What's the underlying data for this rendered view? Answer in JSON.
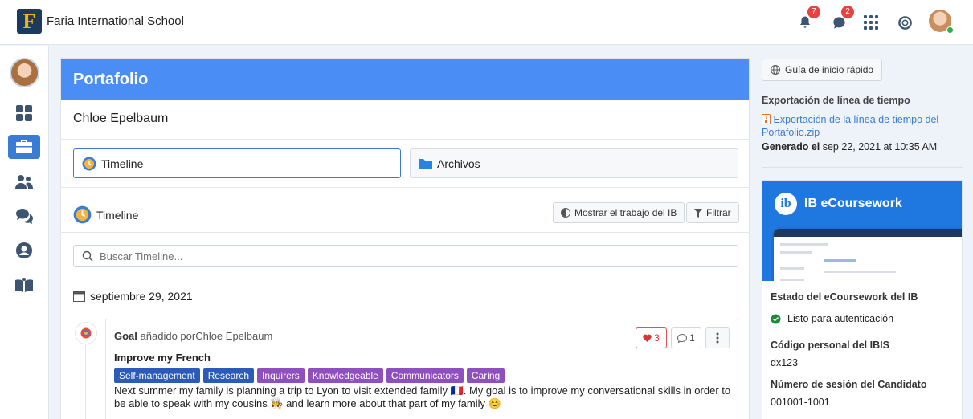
{
  "topbar": {
    "logo_letter": "F",
    "school_name": "Faria International School",
    "notifications_count": "7",
    "messages_count": "2"
  },
  "main": {
    "header_title": "Portafolio",
    "student_name": "Chloe Epelbaum",
    "tabs": [
      {
        "label": "Timeline"
      },
      {
        "label": "Archivos"
      }
    ],
    "timeline_title": "Timeline",
    "show_ib_button": "Mostrar el trabajo del IB",
    "filter_button": "Filtrar",
    "search_placeholder": "Buscar Timeline...",
    "date": "septiembre 29, 2021",
    "entry": {
      "type": "Goal",
      "added_by": "añadido porChloe Epelbaum",
      "title": "Improve my French",
      "tags": [
        {
          "label": "Self-management",
          "color": "#2c5ab8"
        },
        {
          "label": "Research",
          "color": "#2c5ab8"
        },
        {
          "label": "Inquirers",
          "color": "#8e4fbf"
        },
        {
          "label": "Knowledgeable",
          "color": "#8e4fbf"
        },
        {
          "label": "Communicators",
          "color": "#8e4fbf"
        },
        {
          "label": "Caring",
          "color": "#8e4fbf"
        }
      ],
      "text": "Next summer my family is planning a trip to Lyon to visit extended family 🇫🇷. My goal is to improve my conversational skills in order to be able to speak with my cousins 👩‍🍳 and learn more about that part of my family 😊",
      "likes": "3",
      "comments": "1"
    }
  },
  "right": {
    "guide_button": "Guía de inicio rápido",
    "export_label": "Exportación de línea de tiempo",
    "export_link": "Exportación de la línea de tiempo del Portafolio.zip",
    "generated_prefix": "Generado el",
    "generated_date": "sep 22, 2021 at 10:35 AM",
    "ib_title": "IB eCoursework",
    "ib_status_label": "Estado del eCoursework del IB",
    "ib_status_value": "Listo para autenticación",
    "ibis_label": "Código personal del IBIS",
    "ibis_value": "dx123",
    "session_label": "Número de sesión del Candidato",
    "session_value": "001001-1001"
  },
  "colors": {
    "accent": "#4a8ef5",
    "nav_active": "#3a7bd5",
    "ib_blue": "#1f78e0",
    "like_red": "#e05252"
  },
  "icons": [
    "bell-icon",
    "chat-icon",
    "apps-grid-icon",
    "help-lifebuoy-icon",
    "dashboard-icon",
    "portfolio-briefcase-icon",
    "people-icon",
    "messages-icon",
    "profile-icon",
    "book-icon",
    "timeline-clock-icon",
    "folder-icon",
    "search-icon",
    "calendar-icon",
    "filter-icon",
    "heart-icon",
    "comment-icon",
    "more-vertical-icon",
    "globe-icon",
    "zip-file-icon",
    "check-circle-icon"
  ]
}
